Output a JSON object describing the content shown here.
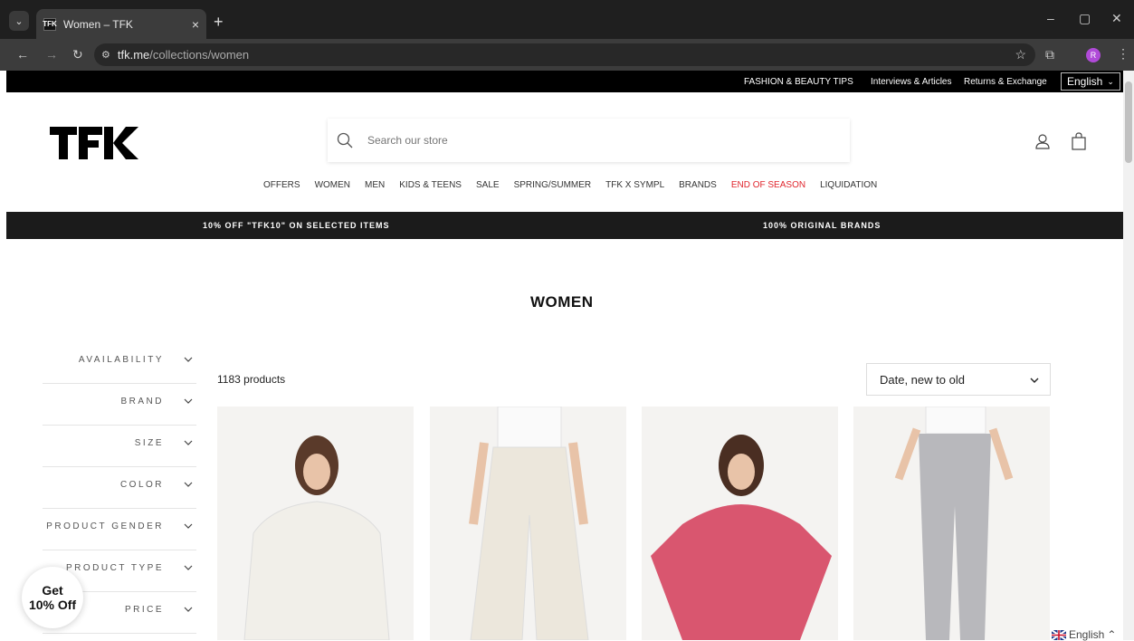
{
  "browser": {
    "tab_title": "Women – TFK",
    "tab_favicon": "TFK",
    "url_host": "tfk.me",
    "url_path": "/collections/women",
    "profile_initial": "R"
  },
  "utility_bar": {
    "links": [
      "FASHION & BEAUTY TIPS",
      "Interviews & Articles",
      "Returns & Exchange"
    ],
    "language": "English"
  },
  "header": {
    "logo_text": "TFK",
    "search_placeholder": "Search our store"
  },
  "main_nav": {
    "items": [
      "OFFERS",
      "WOMEN",
      "MEN",
      "KIDS & TEENS",
      "SALE",
      "SPRING/SUMMER",
      "TFK X SYMPL",
      "BRANDS",
      "END OF SEASON",
      "LIQUIDATION"
    ],
    "highlight_color": "#e0262d"
  },
  "promo": {
    "left": "10% OFF \"TFK10\" ON SELECTED ITEMS",
    "right": "100% ORIGINAL BRANDS"
  },
  "collection": {
    "title": "WOMEN",
    "product_count": "1183 products",
    "sort_value": "Date, new to old"
  },
  "filters": [
    "AVAILABILITY",
    "BRAND",
    "SIZE",
    "COLOR",
    "PRODUCT GENDER",
    "PRODUCT TYPE",
    "PRICE"
  ],
  "products": [
    {
      "name": "white-knit-poncho",
      "color": "#f1efe9"
    },
    {
      "name": "cream-wide-leg-pants",
      "color": "#ece7dc"
    },
    {
      "name": "pink-crochet-poncho",
      "color": "#d9566f"
    },
    {
      "name": "silver-metallic-leggings",
      "color": "#b8b8bc"
    }
  ],
  "widgets": {
    "discount_line1": "Get",
    "discount_line2": "10% Off",
    "language_label": "English"
  }
}
